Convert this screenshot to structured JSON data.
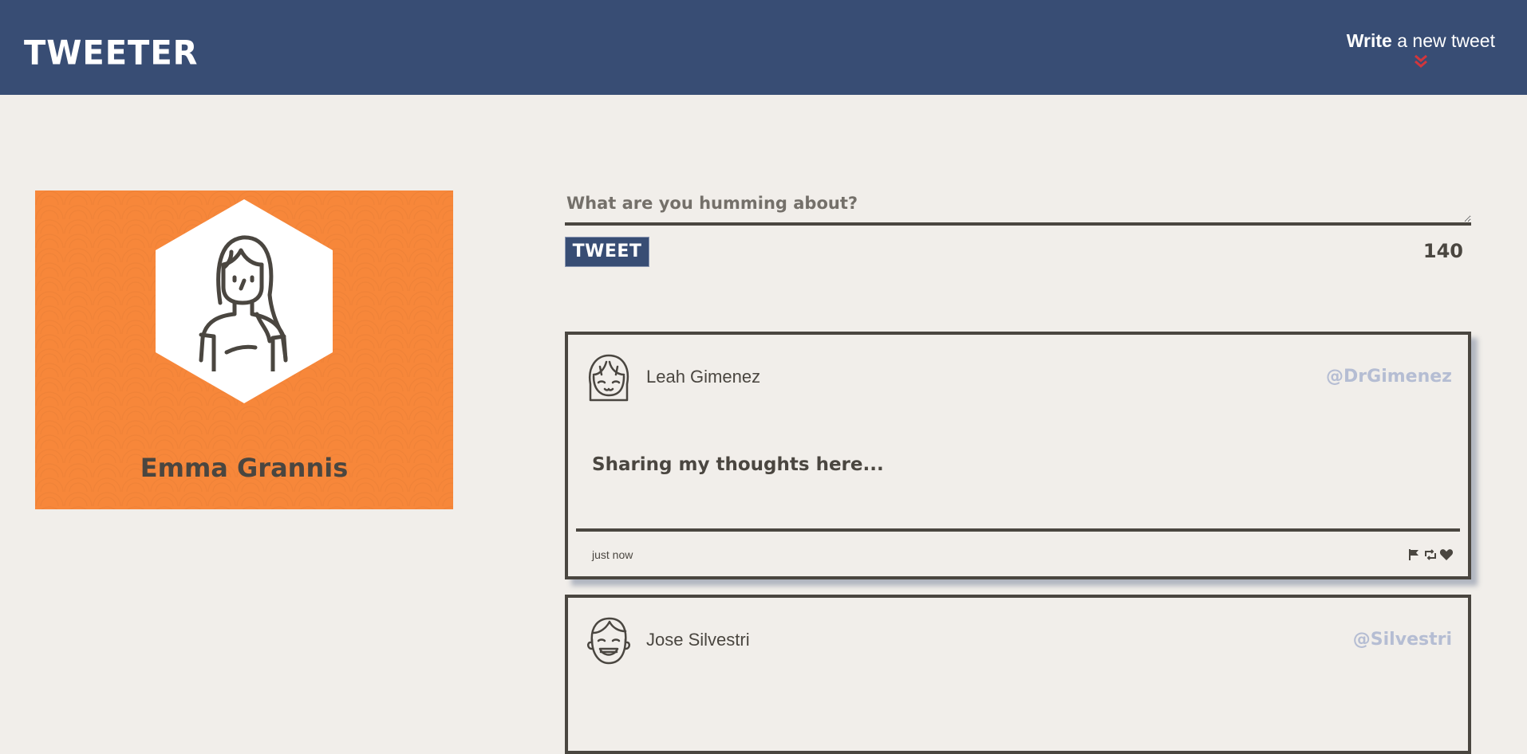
{
  "header": {
    "logo": "TWEETER",
    "compose_bold": "Write",
    "compose_rest": " a new tweet",
    "toggle_icon": "double-chevron-down-icon",
    "accent_color": "#d2363c",
    "background_color": "#384d74"
  },
  "profile": {
    "name": "Emma Grannis",
    "avatar_icon": "woman-avatar-icon",
    "background_color": "#f7873a"
  },
  "composer": {
    "placeholder": "What are you humming about?",
    "value": "",
    "button_label": "TWEET",
    "counter": "140"
  },
  "tweets": [
    {
      "author": "Leah Gimenez",
      "handle": "@DrGimenez",
      "content": "Sharing my thoughts here...",
      "time": "just now",
      "avatar_icon": "girl-avatar-icon",
      "actions": [
        "flag-icon",
        "retweet-icon",
        "heart-icon"
      ]
    },
    {
      "author": "Jose Silvestri",
      "handle": "@Silvestri",
      "avatar_icon": "boy-avatar-icon"
    }
  ]
}
